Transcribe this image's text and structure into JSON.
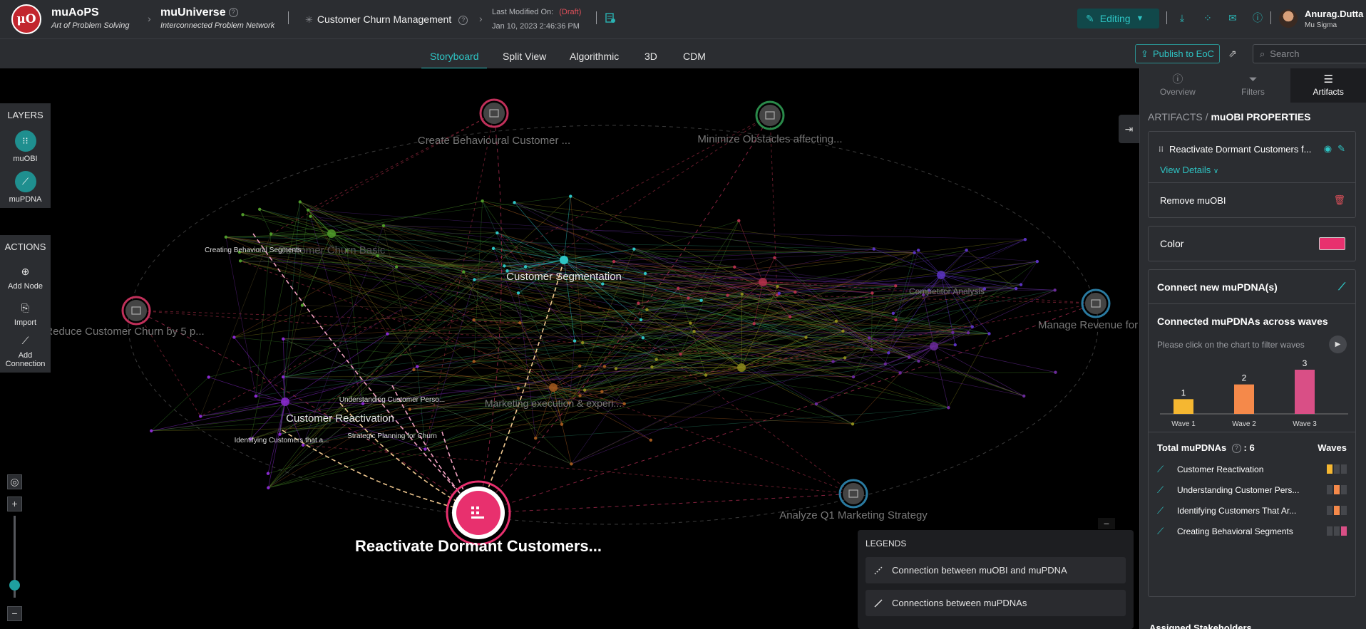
{
  "header": {
    "logo_text": "μO",
    "app_name": "muAoPS",
    "app_tagline": "Art of Problem Solving",
    "universe_name": "muUniverse",
    "universe_tagline": "Interconnected Problem Network",
    "problem_title": "Customer Churn Management",
    "last_modified_label": "Last Modified On:",
    "draft_label": "(Draft)",
    "last_modified_date": "Jan 10, 2023 2:46:36 PM",
    "mode_label": "Editing",
    "user_name": "Anurag.Dutta",
    "user_org": "Mu Sigma"
  },
  "tabs": [
    "Storyboard",
    "Split View",
    "Algorithmic",
    "3D",
    "CDM"
  ],
  "active_tab": "Storyboard",
  "toolbar": {
    "publish_label": "Publish to EoC",
    "search_placeholder": "Search"
  },
  "layers": {
    "title": "LAYERS",
    "items": [
      "muOBI",
      "muPDNA"
    ]
  },
  "actions": {
    "title": "ACTIONS",
    "items": [
      "Add Node",
      "Import",
      "Add Connection"
    ]
  },
  "graph": {
    "objectives": [
      "Create Behavioural Customer ...",
      "Minimize Obstacles affecting...",
      "Reduce Customer Churn by 5 p...",
      "Manage Revenue for",
      "Analyze Q1 Marketing Strategy"
    ],
    "selected": "Reactivate Dormant Customers...",
    "hub_labels": [
      "Customer Segmentation",
      "Customer Reactivation",
      "Marketing execution & experi...",
      "Competitor Analysis",
      "Customer Churn Basic"
    ],
    "small_labels": [
      "Creating Behavioral Segments",
      "Understanding Customer Perso...",
      "Strategic Planning for Churn",
      "Identifying Customers that a..."
    ]
  },
  "legends": {
    "title": "LEGENDS",
    "items": [
      "Connection between muOBI and muPDNA",
      "Connections between muPDNAs"
    ]
  },
  "panel": {
    "tabs": [
      "Overview",
      "Filters",
      "Artifacts"
    ],
    "active_tab": "Artifacts",
    "breadcrumb_root": "ARTIFACTS",
    "breadcrumb_current": "muOBI PROPERTIES",
    "obi_name": "Reactivate Dormant Customers f...",
    "view_details": "View Details",
    "remove_label": "Remove muOBI",
    "color_label": "Color",
    "color_value": "#e8306e",
    "connect_label": "Connect new muPDNA(s)",
    "waves_title": "Connected muPDNAs across waves",
    "waves_hint": "Please click on the chart to filter waves",
    "total_label": "Total muPDNAs",
    "total_value": ": 6",
    "waves_col": "Waves",
    "pdnas": [
      {
        "name": "Customer Reactivation",
        "wave": 1
      },
      {
        "name": "Understanding Customer Pers...",
        "wave": 2
      },
      {
        "name": "Identifying Customers That Ar...",
        "wave": 2
      },
      {
        "name": "Creating Behavioral Segments",
        "wave": 3
      }
    ],
    "next_section_peek": "Assigned Stakeholders"
  },
  "chart_data": {
    "type": "bar",
    "categories": [
      "Wave 1",
      "Wave 2",
      "Wave 3"
    ],
    "values": [
      1,
      2,
      3
    ],
    "colors": [
      "#f5b731",
      "#f5894a",
      "#d94f86"
    ],
    "ylim": [
      0,
      3
    ]
  }
}
